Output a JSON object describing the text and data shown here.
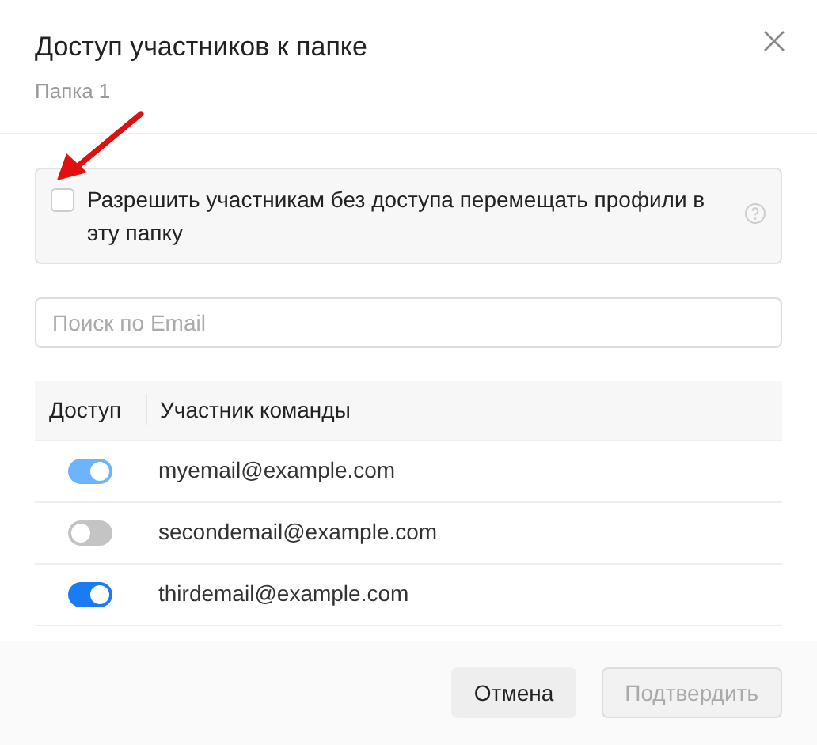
{
  "dialog": {
    "title": "Доступ участников к папке",
    "subtitle": "Папка 1"
  },
  "permission": {
    "label": "Разрешить участникам без доступа перемещать профили в эту папку",
    "checked": false
  },
  "search": {
    "placeholder": "Поиск по Email"
  },
  "table": {
    "columns": [
      "Доступ",
      "Участник команды"
    ],
    "rows": [
      {
        "email": "myemail@example.com",
        "on": true,
        "disabled": true
      },
      {
        "email": "secondemail@example.com",
        "on": false,
        "disabled": false
      },
      {
        "email": "thirdemail@example.com",
        "on": true,
        "disabled": false
      }
    ]
  },
  "buttons": [
    {
      "label": "Отмена",
      "disabled": false
    },
    {
      "label": "Подтвердить",
      "disabled": true
    }
  ]
}
